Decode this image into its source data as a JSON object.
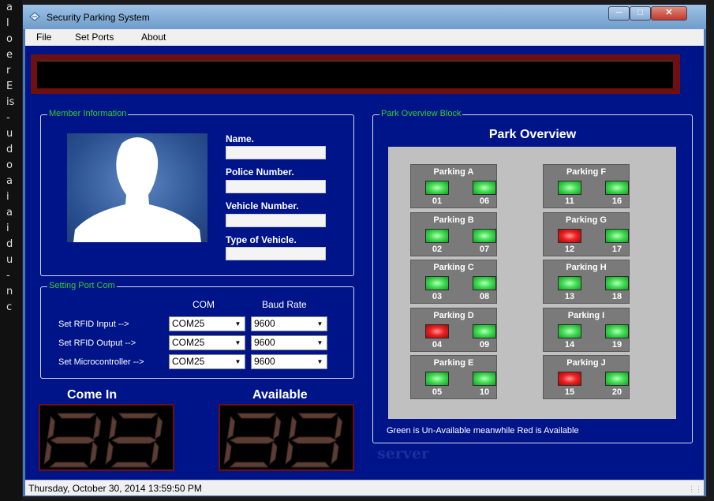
{
  "window": {
    "title": "Security Parking System"
  },
  "menu": [
    "File",
    "Set Ports",
    "About"
  ],
  "member_info": {
    "legend": "Member Information",
    "fields": [
      {
        "label": "Name.",
        "value": ""
      },
      {
        "label": "Police Number.",
        "value": ""
      },
      {
        "label": "Vehicle Number.",
        "value": ""
      },
      {
        "label": "Type of Vehicle.",
        "value": ""
      }
    ]
  },
  "port_settings": {
    "legend": "Setting Port Com",
    "col_com": "COM",
    "col_baud": "Baud Rate",
    "rows": [
      {
        "label": "Set RFID Input -->",
        "com": "COM25",
        "baud": "9600"
      },
      {
        "label": "Set RFID Output -->",
        "com": "COM25",
        "baud": "9600"
      },
      {
        "label": "Set Microcontroller -->",
        "com": "COM25",
        "baud": "9600"
      }
    ]
  },
  "counters": {
    "come_in_label": "Come In",
    "available_label": "Available"
  },
  "park_overview": {
    "legend": "Park Overview Block",
    "title": "Park Overview",
    "note": "Green is Un-Available meanwhile Red is Available",
    "blocks": [
      {
        "name": "Parking A",
        "slots": [
          {
            "num": "01",
            "status": "green"
          },
          {
            "num": "06",
            "status": "green"
          }
        ]
      },
      {
        "name": "Parking B",
        "slots": [
          {
            "num": "02",
            "status": "green"
          },
          {
            "num": "07",
            "status": "green"
          }
        ]
      },
      {
        "name": "Parking C",
        "slots": [
          {
            "num": "03",
            "status": "green"
          },
          {
            "num": "08",
            "status": "green"
          }
        ]
      },
      {
        "name": "Parking D",
        "slots": [
          {
            "num": "04",
            "status": "red"
          },
          {
            "num": "09",
            "status": "green"
          }
        ]
      },
      {
        "name": "Parking E",
        "slots": [
          {
            "num": "05",
            "status": "green"
          },
          {
            "num": "10",
            "status": "green"
          }
        ]
      },
      {
        "name": "Parking F",
        "slots": [
          {
            "num": "11",
            "status": "green"
          },
          {
            "num": "16",
            "status": "green"
          }
        ]
      },
      {
        "name": "Parking G",
        "slots": [
          {
            "num": "12",
            "status": "red"
          },
          {
            "num": "17",
            "status": "green"
          }
        ]
      },
      {
        "name": "Parking H",
        "slots": [
          {
            "num": "13",
            "status": "green"
          },
          {
            "num": "18",
            "status": "green"
          }
        ]
      },
      {
        "name": "Parking I",
        "slots": [
          {
            "num": "14",
            "status": "green"
          },
          {
            "num": "19",
            "status": "green"
          }
        ]
      },
      {
        "name": "Parking J",
        "slots": [
          {
            "num": "15",
            "status": "red"
          },
          {
            "num": "20",
            "status": "green"
          }
        ]
      }
    ]
  },
  "server_label": "server",
  "status_bar": "Thursday, October 30, 2014  13:59:50 PM",
  "colors": {
    "background": "#00148a",
    "accent_green": "#3c3",
    "available_red": "#ee2222",
    "occupied_green": "#44dd55"
  }
}
